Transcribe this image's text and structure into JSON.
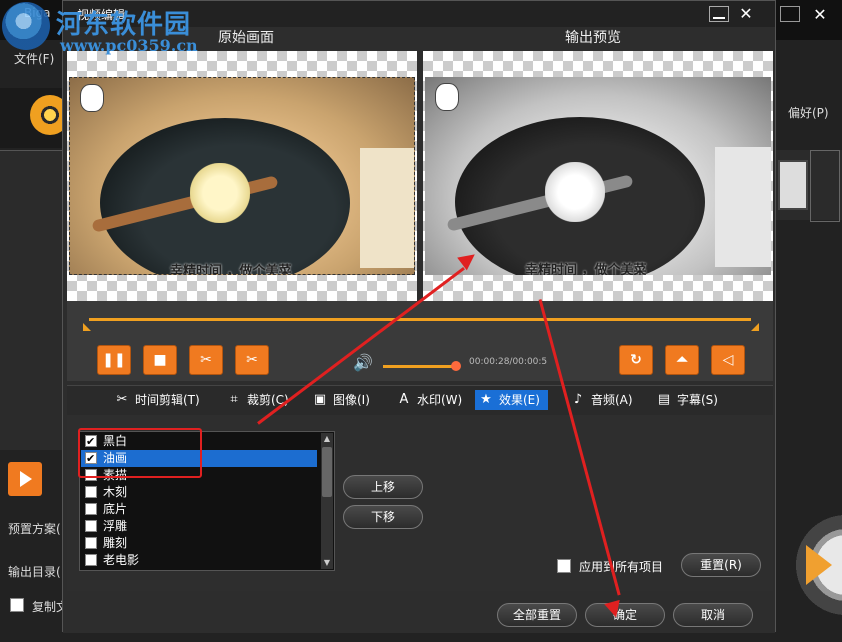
{
  "background_app": {
    "title": "Biga",
    "file_menu": "文件(F)",
    "preferences_menu": "偏好(P)",
    "preset_label": "预置方案(",
    "output_dir_label": "输出目录(",
    "copy_label": "复制文"
  },
  "watermark": {
    "text": "河东软件园",
    "url": "www.pc0359.cn"
  },
  "dialog": {
    "title": "视频编辑",
    "original_label": "原始画面",
    "output_label": "输出预览",
    "caption_left": "幸精时间 ，做个美菜",
    "caption_right": "幸精时间 ，做个美菜",
    "timecode": "00:00:28/00:00:5",
    "tabs": [
      {
        "label": "时间剪辑(T)",
        "icon": "scissors-icon",
        "glyph": "✂"
      },
      {
        "label": "裁剪(C)",
        "icon": "crop-icon",
        "glyph": "⌗"
      },
      {
        "label": "图像(I)",
        "icon": "image-icon",
        "glyph": "▣"
      },
      {
        "label": "水印(W)",
        "icon": "watermark-icon",
        "glyph": "A"
      },
      {
        "label": "效果(E)",
        "icon": "star-icon",
        "glyph": "★"
      },
      {
        "label": "音频(A)",
        "icon": "music-note-icon",
        "glyph": "♪"
      },
      {
        "label": "字幕(S)",
        "icon": "subtitle-icon",
        "glyph": "▤"
      }
    ],
    "effects": [
      {
        "label": "黑白",
        "checked": true,
        "selected": false
      },
      {
        "label": "油画",
        "checked": true,
        "selected": true
      },
      {
        "label": "素描",
        "checked": false,
        "selected": false
      },
      {
        "label": "木刻",
        "checked": false,
        "selected": false
      },
      {
        "label": "底片",
        "checked": false,
        "selected": false
      },
      {
        "label": "浮雕",
        "checked": false,
        "selected": false
      },
      {
        "label": "雕刻",
        "checked": false,
        "selected": false
      },
      {
        "label": "老电影",
        "checked": false,
        "selected": false
      }
    ],
    "move_up": "上移",
    "move_down": "下移",
    "apply_all": "应用到所有项目",
    "reset": "重置(R)",
    "reset_all": "全部重置",
    "ok": "确定",
    "cancel": "取消"
  },
  "colors": {
    "accent": "#f07a20",
    "selection": "#1c6dd0",
    "annotation": "#e02020"
  }
}
